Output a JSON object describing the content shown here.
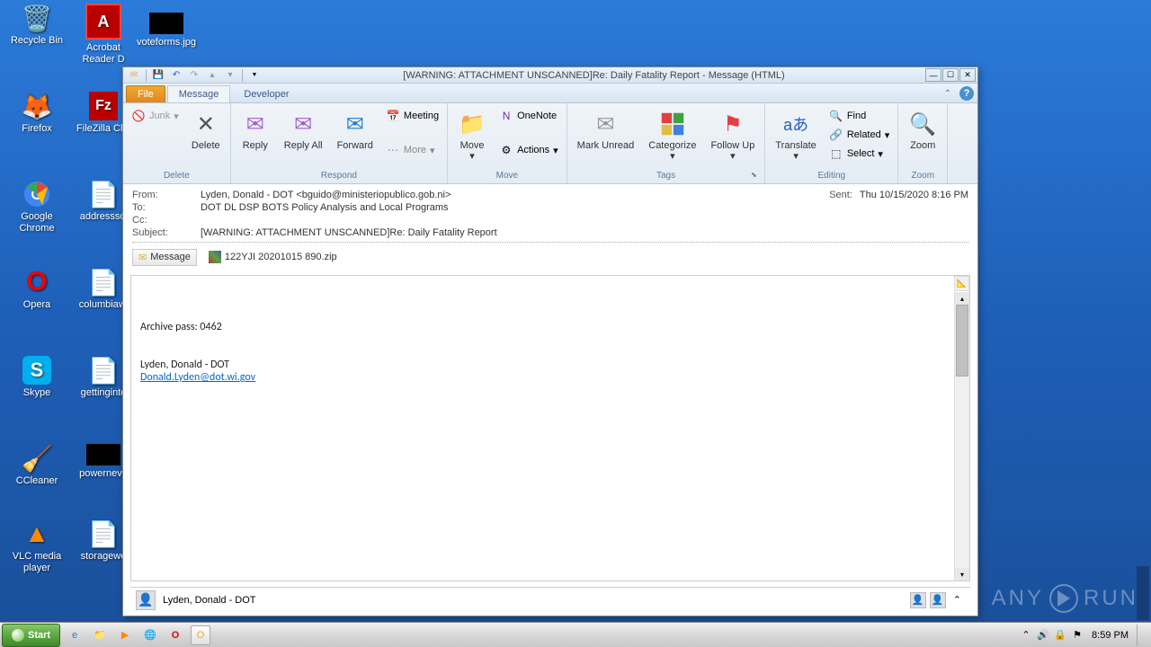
{
  "desktop": {
    "icons": [
      {
        "label": "Recycle Bin",
        "glyph": "🗑️"
      },
      {
        "label": "Acrobat Reader D",
        "glyph": "📕"
      },
      {
        "label": "voteforms.jpg",
        "glyph": "▪"
      },
      {
        "label": "Firefox",
        "glyph": "🦊"
      },
      {
        "label": "FileZilla Clie",
        "glyph": "Fz"
      },
      {
        "label": "Google Chrome",
        "glyph": "🌐"
      },
      {
        "label": "addresssci",
        "glyph": "📄"
      },
      {
        "label": "Opera",
        "glyph": "O"
      },
      {
        "label": "columbiawi",
        "glyph": "📄"
      },
      {
        "label": "Skype",
        "glyph": "S"
      },
      {
        "label": "gettinginte",
        "glyph": "📄"
      },
      {
        "label": "CCleaner",
        "glyph": "🧹"
      },
      {
        "label": "powerneve",
        "glyph": "▪"
      },
      {
        "label": "VLC media player",
        "glyph": "🔺"
      },
      {
        "label": "storagewe",
        "glyph": "📄"
      }
    ]
  },
  "taskbar": {
    "start": "Start",
    "clock": "8:59 PM"
  },
  "outlook": {
    "title": "[WARNING: ATTACHMENT UNSCANNED]Re: Daily Fatality Report  -  Message (HTML)",
    "tabs": {
      "file": "File",
      "message": "Message",
      "developer": "Developer"
    },
    "ribbon": {
      "junk": "Junk",
      "delete": "Delete",
      "reply": "Reply",
      "replyall": "Reply All",
      "forward": "Forward",
      "meeting": "Meeting",
      "more": "More",
      "move": "Move",
      "onenote": "OneNote",
      "actions": "Actions",
      "markunread": "Mark Unread",
      "categorize": "Categorize",
      "followup": "Follow Up",
      "translate": "Translate",
      "find": "Find",
      "related": "Related",
      "select": "Select",
      "zoom": "Zoom",
      "groups": {
        "delete": "Delete",
        "respond": "Respond",
        "move": "Move",
        "tags": "Tags",
        "editing": "Editing",
        "zoom": "Zoom"
      }
    },
    "headers": {
      "from_label": "From:",
      "from": "Lyden, Donald - DOT <bguido@ministeriopublico.gob.ni>",
      "to_label": "To:",
      "to": "DOT DL DSP BOTS Policy Analysis and Local Programs",
      "cc_label": "Cc:",
      "cc": "",
      "subject_label": "Subject:",
      "subject": "[WARNING: ATTACHMENT UNSCANNED]Re: Daily Fatality Report",
      "sent_label": "Sent:",
      "sent": "Thu 10/15/2020 8:16 PM"
    },
    "attachments": {
      "message_tab": "Message",
      "file": "122YJI 20201015 890.zip"
    },
    "body": {
      "line1": "Archive pass: 0462",
      "signature_name": "Lyden, Donald - DOT",
      "signature_email": "Donald.Lyden@dot.wi.gov"
    },
    "people": {
      "name": "Lyden, Donald - DOT"
    }
  },
  "watermark": {
    "a": "ANY",
    "b": "RUN"
  }
}
